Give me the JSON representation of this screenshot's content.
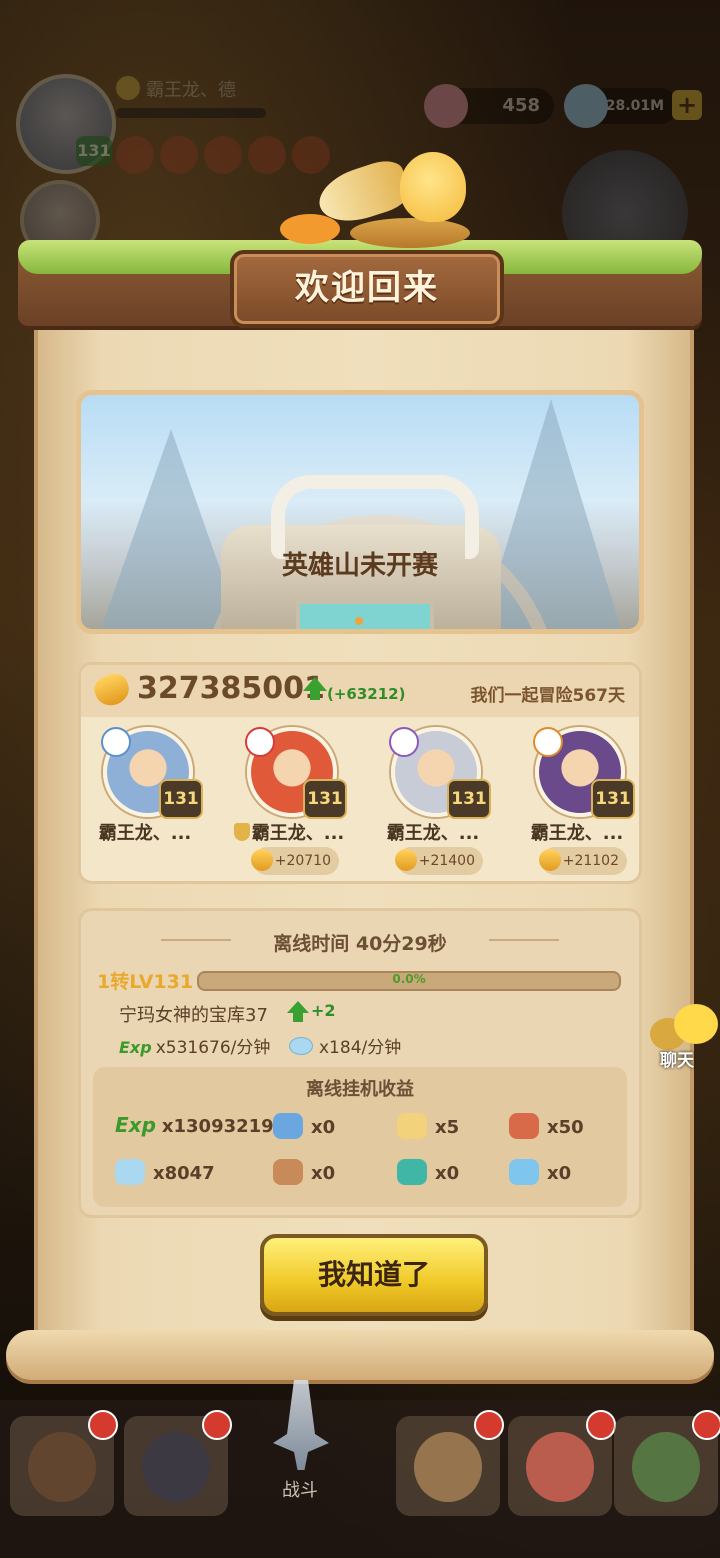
{
  "hud": {
    "player_name": "霸王龙、德",
    "player_level": "131",
    "resources": [
      {
        "icon": "gem-icon",
        "value": "458"
      },
      {
        "icon": "crystal-icon",
        "value": "1428.01M"
      }
    ]
  },
  "dialog": {
    "title": "欢迎回来",
    "banner_text": "英雄山未开赛",
    "combat_power": "327385001",
    "combat_power_delta": "(+63212)",
    "adventure_days": "我们一起冒险567天",
    "heroes": [
      {
        "name": "霸王龙、...",
        "level": "131",
        "element": "water",
        "gain": "",
        "face_color": "#8fb0d6",
        "accent": "#5a8fd0"
      },
      {
        "name": "霸王龙、...",
        "level": "131",
        "element": "fire",
        "gain": "+20710",
        "face_color": "#e05a3a",
        "accent": "#d83a3a"
      },
      {
        "name": "霸王龙、...",
        "level": "131",
        "element": "wind",
        "gain": "+21400",
        "face_color": "#c8ccd6",
        "accent": "#8a5ac0"
      },
      {
        "name": "霸王龙、...",
        "level": "131",
        "element": "thunder",
        "gain": "+21102",
        "face_color": "#6a4a8a",
        "accent": "#e08a2a"
      }
    ],
    "offline": {
      "title": "离线时间 40分29秒",
      "level_label": "1转LV131",
      "progress_text": "0.0%",
      "progress": 0.0,
      "stage": "宁玛女神的宝库37",
      "stage_increase": "+2",
      "exp_icon": "Exp",
      "exp_rate": "x531676/分钟",
      "crystal_rate": "x184/分钟"
    },
    "earnings": {
      "title": "离线挂机收益",
      "items": [
        {
          "icon": "exp-icon",
          "label": "Exp",
          "value": "x13093219"
        },
        {
          "icon": "scroll-icon",
          "value": "x0",
          "color": "#6aa6e0"
        },
        {
          "icon": "candle-icon",
          "value": "x5",
          "color": "#f2d27a"
        },
        {
          "icon": "medal-icon",
          "value": "x50",
          "color": "#d86a4a"
        },
        {
          "icon": "crystal-icon",
          "value": "x8047",
          "color": "#a9d8f0"
        },
        {
          "icon": "meat-icon",
          "value": "x0",
          "color": "#c98a5a"
        },
        {
          "icon": "teal-gem-icon",
          "value": "x0",
          "color": "#3fb6a6"
        },
        {
          "icon": "ice-shard-icon",
          "value": "x0",
          "color": "#7fc6ee"
        }
      ]
    },
    "confirm_label": "我知道了"
  },
  "chat_label": "聊天",
  "nav": {
    "fight_label": "战斗"
  }
}
